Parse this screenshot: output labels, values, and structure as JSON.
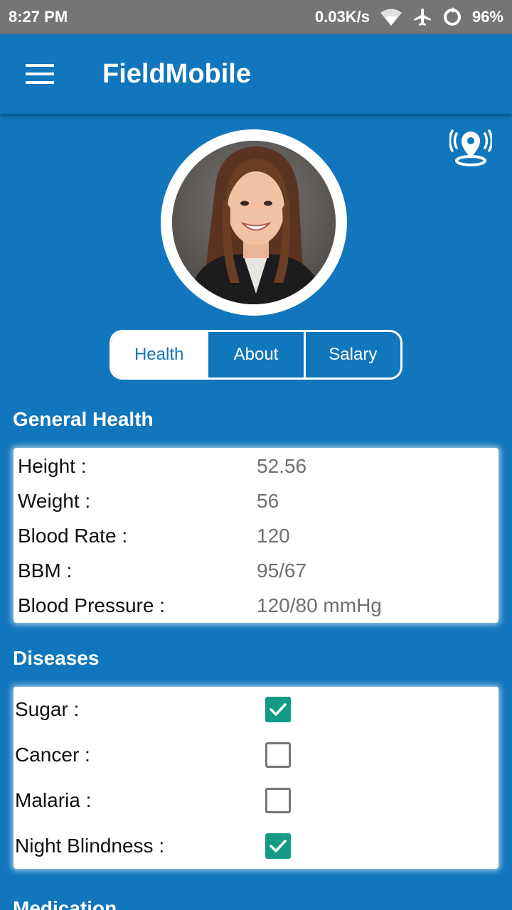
{
  "status_bar": {
    "time": "8:27 PM",
    "speed": "0.03K/s",
    "battery": "96%",
    "icons": [
      "wifi-icon",
      "airplane-icon",
      "sync-icon"
    ]
  },
  "app_bar": {
    "title": "FieldMobile",
    "menu_icon": "hamburger-menu-icon"
  },
  "profile": {
    "location_icon": "location-broadcast-icon",
    "avatar": "profile-photo"
  },
  "tabs": [
    {
      "label": "Health",
      "active": true
    },
    {
      "label": "About",
      "active": false
    },
    {
      "label": "Salary",
      "active": false
    }
  ],
  "general_health": {
    "title": "General Health",
    "rows": [
      {
        "label": "Height :",
        "value": "52.56"
      },
      {
        "label": "Weight :",
        "value": "56"
      },
      {
        "label": "Blood Rate :",
        "value": "120"
      },
      {
        "label": "BBM :",
        "value": "95/67"
      },
      {
        "label": "Blood Pressure :",
        "value": "120/80 mmHg"
      }
    ]
  },
  "diseases": {
    "title": "Diseases",
    "rows": [
      {
        "label": "Sugar :",
        "checked": true
      },
      {
        "label": "Cancer :",
        "checked": false
      },
      {
        "label": "Malaria :",
        "checked": false
      },
      {
        "label": "Night Blindness :",
        "checked": true
      }
    ]
  },
  "medication": {
    "title": "Medication"
  },
  "colors": {
    "primary": "#1176BC",
    "status_bar": "#757575",
    "checkbox_checked": "#139B86",
    "value_text": "#6f6f6f"
  }
}
